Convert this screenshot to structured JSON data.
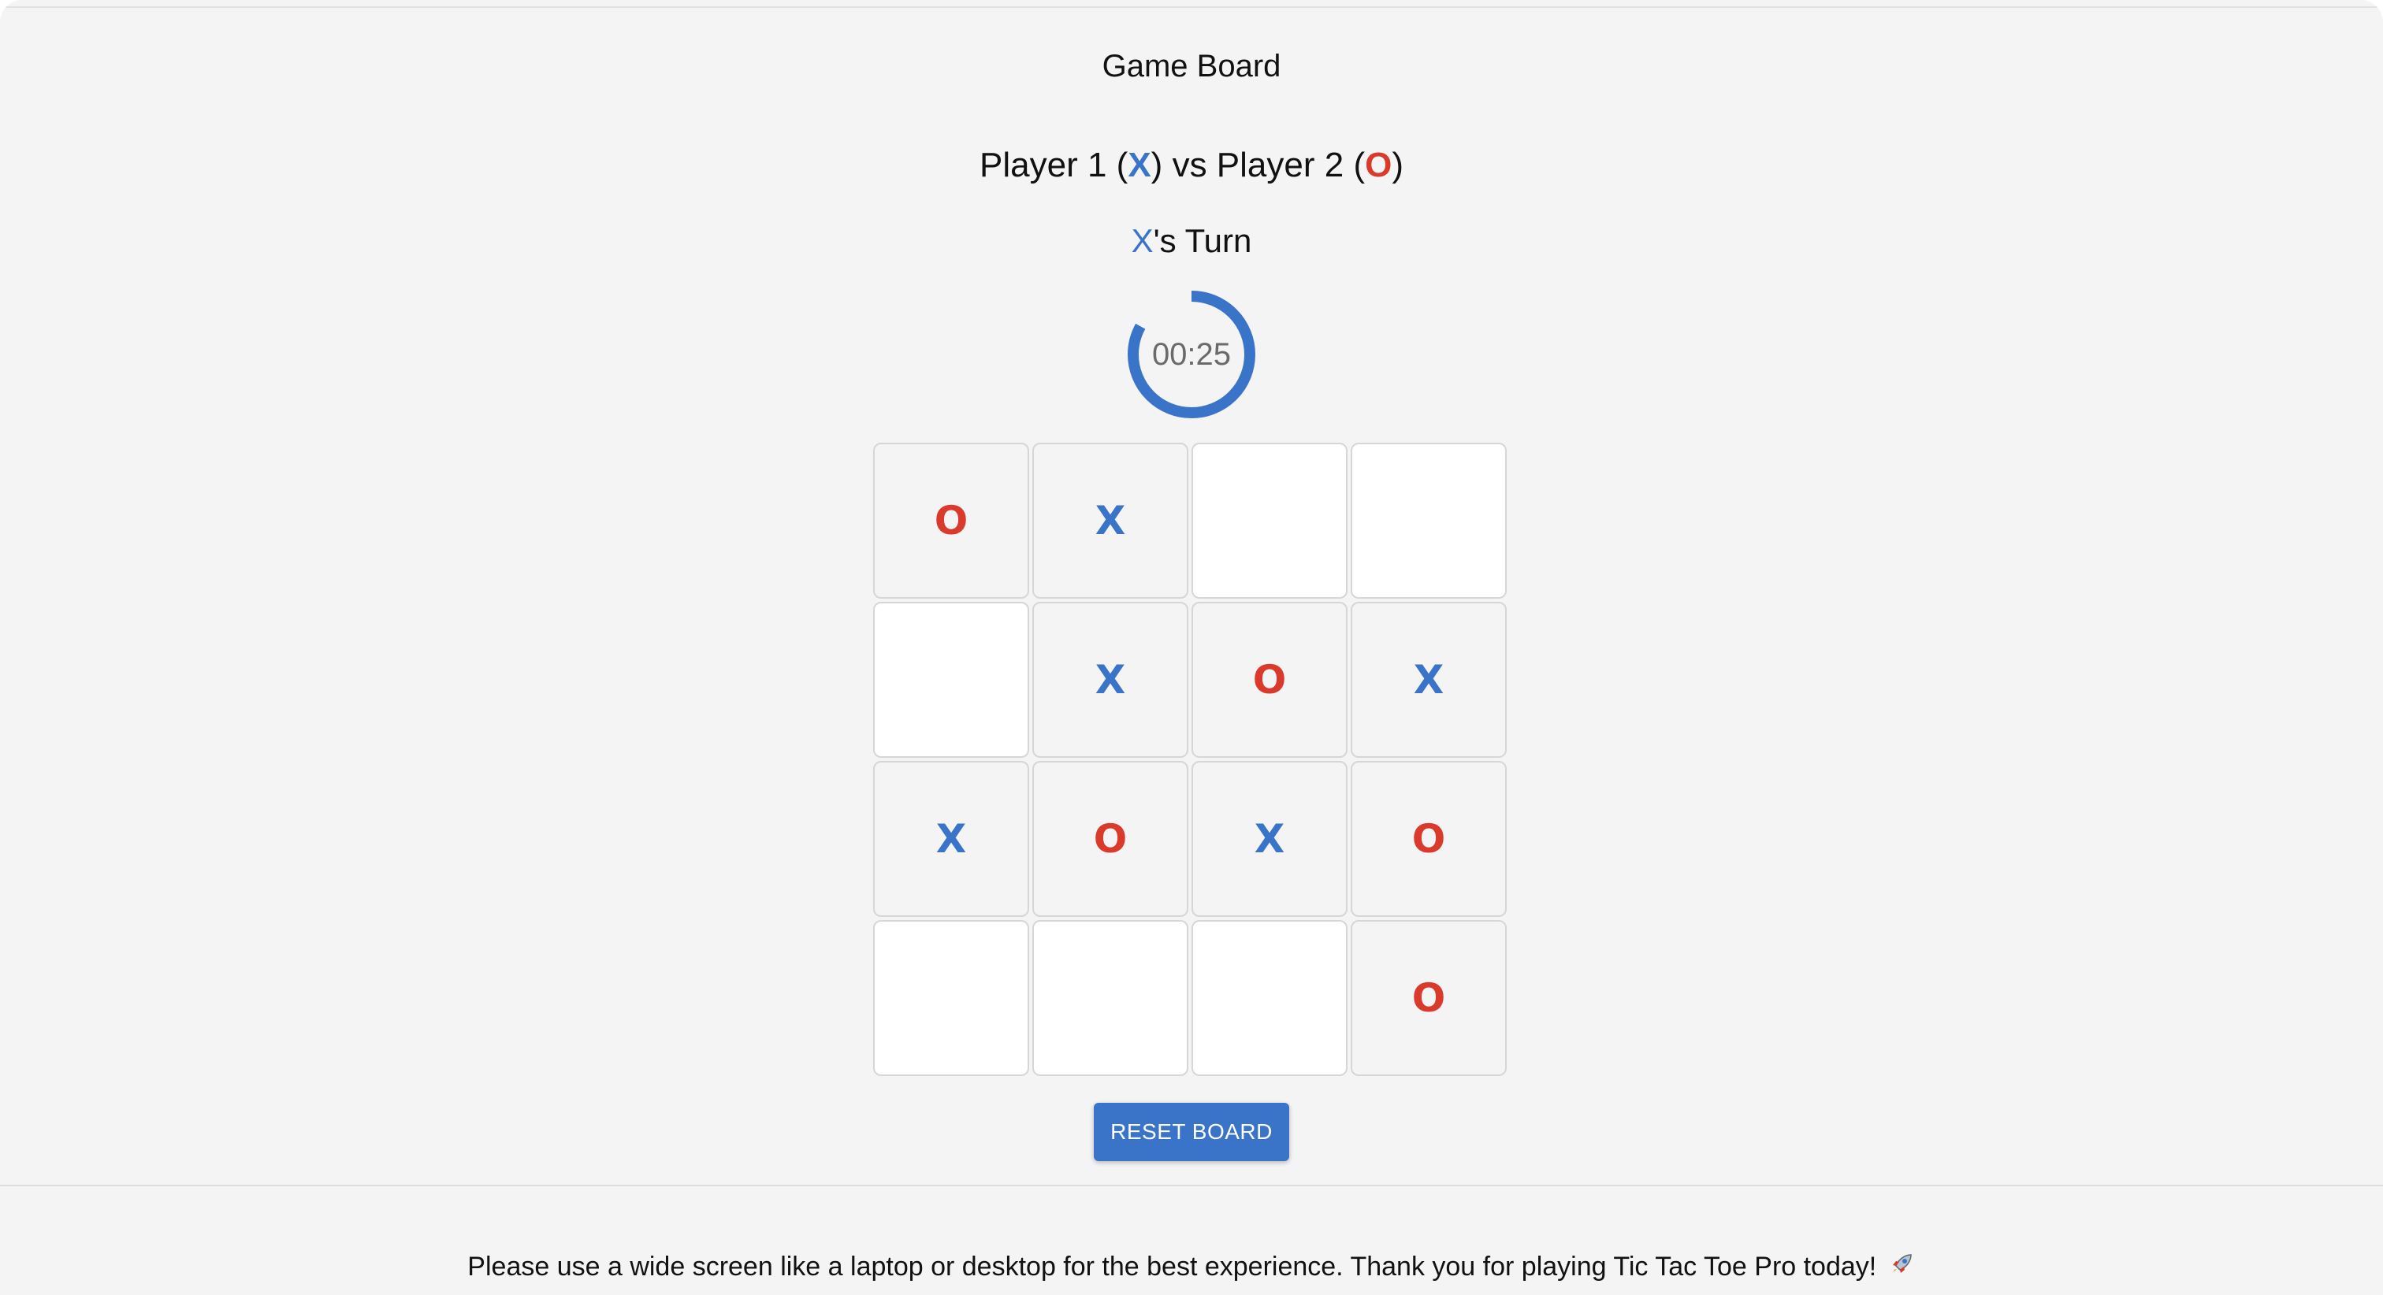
{
  "header": {
    "title": "Game Board"
  },
  "players": {
    "player1_label": "Player 1",
    "player1_mark": "X",
    "vs_label": "vs",
    "player2_label": "Player 2",
    "player2_mark": "O"
  },
  "turn": {
    "mark": "X",
    "suffix": "'s Turn"
  },
  "timer": {
    "display": "00:25",
    "progress_fraction": 0.83,
    "ring_color": "#3a74c9"
  },
  "board": {
    "rows": 4,
    "cols": 4,
    "cells": [
      [
        "O",
        "X",
        "",
        ""
      ],
      [
        "",
        "X",
        "O",
        "X"
      ],
      [
        "X",
        "O",
        "X",
        "O"
      ],
      [
        "",
        "",
        "",
        "O"
      ]
    ]
  },
  "reset_button": {
    "label": "RESET BOARD"
  },
  "footer": {
    "message": "Please use a wide screen like a laptop or desktop for the best experience. Thank you for playing Tic Tac Toe Pro today!",
    "icon": "rocket-icon"
  },
  "colors": {
    "x_color": "#3a74c9",
    "o_color": "#d93a2b",
    "accent": "#3a74c9",
    "background": "#f4f4f4"
  }
}
